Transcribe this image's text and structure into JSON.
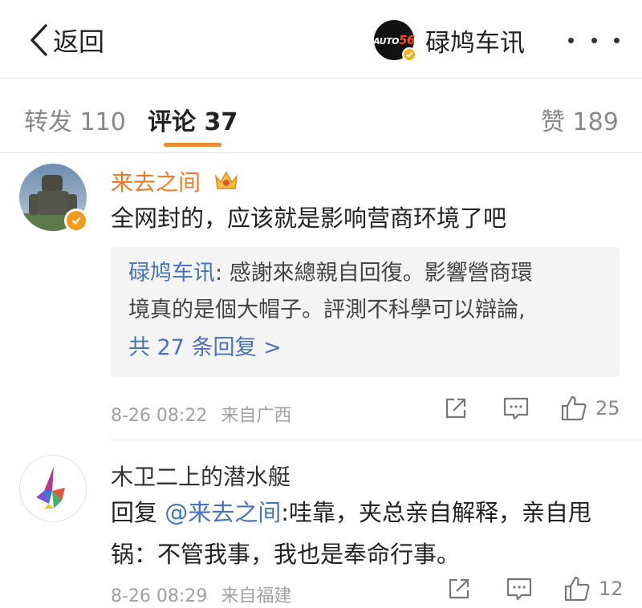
{
  "header": {
    "back_label": "返回",
    "account_name": "碌鸠车讯",
    "account_logo_prefix": "AUTO",
    "account_logo_num": "56"
  },
  "tabs": [
    {
      "label": "转发 110"
    },
    {
      "label": "评论 37"
    },
    {
      "label": "赞 189"
    }
  ],
  "active_tab": 1,
  "accent_color": "#f08a2e",
  "link_color": "#4a72b8",
  "comments": [
    {
      "user": "来去之间",
      "user_color": "#f0782c",
      "text": "全网封的，应该就是影响营商环境了吧",
      "reply": {
        "author": "碌鸠车讯",
        "line1": ": 感謝來總親自回復。影響營商環",
        "line2": "境真的是個大帽子。評測不科學可以辯論,",
        "more": "共 27 条回复 >"
      },
      "time": "8-26 08:22",
      "source": "来自广西",
      "likes": "25"
    },
    {
      "user": "木卫二上的潜水艇",
      "user_color": "#333333",
      "reply_prefix": "回复 ",
      "mention": "@来去之间",
      "text": ":哇靠，夹总亲自解释，亲自甩锅：不管我事，我也是奉命行事。",
      "time": "8-26 08:29",
      "source": "来自福建",
      "likes": "12"
    }
  ],
  "icons": [
    "chevron-left-icon",
    "more-icon",
    "crown-icon",
    "verified-icon",
    "share-icon",
    "comment-icon",
    "like-icon"
  ]
}
